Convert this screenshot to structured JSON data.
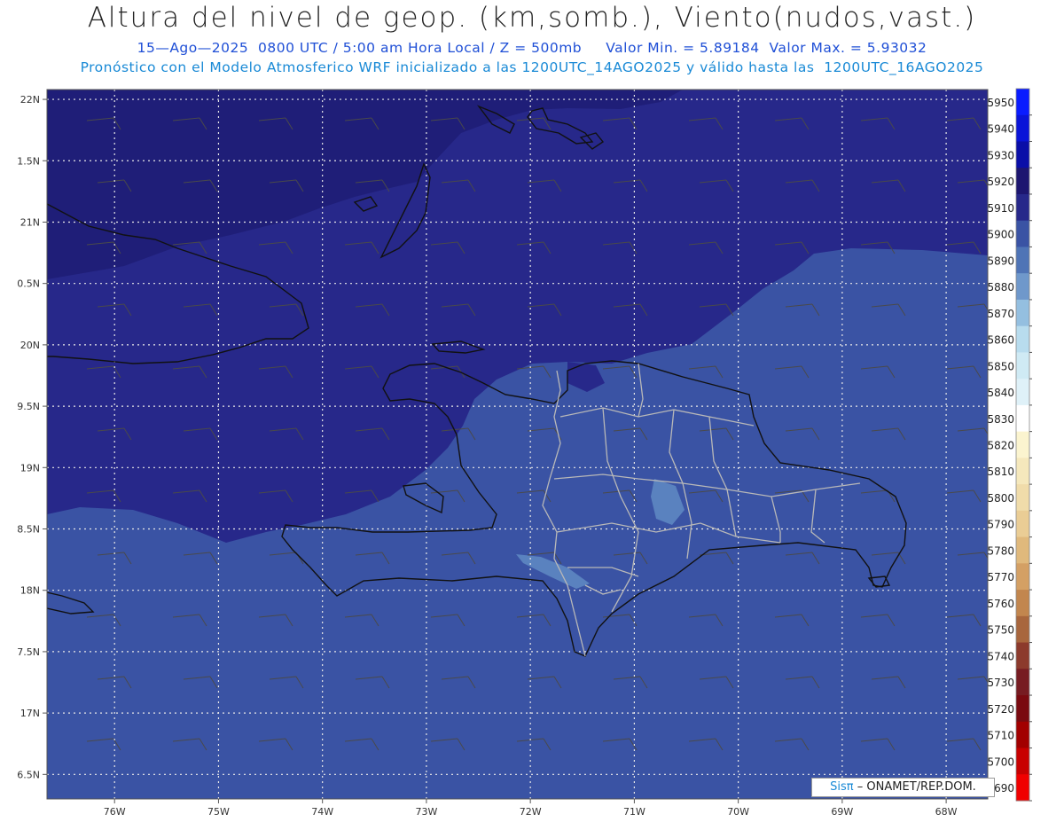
{
  "title": "Altura del nivel de geop. (km,somb.), Viento(nudos,vast.)",
  "subtitle1": "15—Ago—2025  0800 UTC / 5:00 am Hora Local / Z = 500mb     Valor Min. = 5.89184  Valor Max. = 5.93032",
  "subtitle2": "Pronóstico con el Modelo Atmosferico WRF inicializado a las 1200UTC_14AGO2025 y válido hasta las  1200UTC_16AGO2025",
  "credit": {
    "brand": "Sisπ",
    "text": "– ONAMET/REP.DOM."
  },
  "map": {
    "lon_range": [
      -76.65,
      -67.6
    ],
    "lat_range": [
      16.3,
      22.08
    ],
    "lon_ticks": [
      "76W",
      "75W",
      "74W",
      "73W",
      "72W",
      "71W",
      "70W",
      "69W",
      "68W"
    ],
    "lon_values": [
      -76,
      -75,
      -74,
      -73,
      -72,
      -71,
      -70,
      -69,
      -68
    ],
    "lat_ticks": [
      "22N",
      "1.5N",
      "21N",
      "0.5N",
      "20N",
      "9.5N",
      "19N",
      "8.5N",
      "18N",
      "7.5N",
      "17N",
      "6.5N"
    ],
    "lat_values": [
      22,
      21.5,
      21,
      20.5,
      20,
      19.5,
      19,
      18.5,
      18,
      17.5,
      17,
      16.5
    ],
    "fill_colors": {
      "z5920": "#1f1e78",
      "z5910": "#27288a",
      "z5900": "#3a53a4",
      "z5890": "#5a82bf",
      "coast": "#111111",
      "border": "#b0b0b0"
    }
  },
  "colorbar": {
    "labels": [
      "5950",
      "5940",
      "5930",
      "5920",
      "5910",
      "5900",
      "5890",
      "5880",
      "5870",
      "5860",
      "5850",
      "5840",
      "5830",
      "5820",
      "5810",
      "5800",
      "5790",
      "5780",
      "5770",
      "5760",
      "5750",
      "5740",
      "5730",
      "5720",
      "5710",
      "5700",
      "5690"
    ],
    "colors": [
      "#0a1cff",
      "#0a14d8",
      "#0a0ea8",
      "#1d1670",
      "#27288a",
      "#3a53a4",
      "#4f74b6",
      "#6f98cb",
      "#94bfe0",
      "#b8dcee",
      "#cfeaf4",
      "#dff1f8",
      "#ffffff",
      "#fbf4cf",
      "#f5e8bc",
      "#f0dcaa",
      "#eacd95",
      "#e0b97c",
      "#d4a064",
      "#c2864e",
      "#a8663d",
      "#8c3a2c",
      "#771c22",
      "#7a0a10",
      "#a20000",
      "#c80000",
      "#f00000"
    ]
  }
}
